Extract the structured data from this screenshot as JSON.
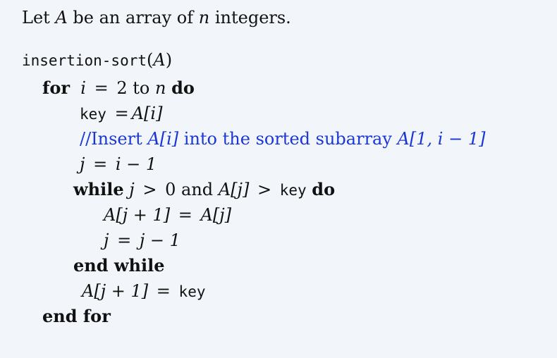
{
  "intro": {
    "pre": "Let",
    "var_A": "A",
    "mid": "be an array of",
    "var_n": "n",
    "post": "integers."
  },
  "code": {
    "func_name": "insertion-sort",
    "func_open": "(",
    "func_arg": "A",
    "func_close": ")",
    "for_kw": "for",
    "for_var": "i",
    "for_eq": "=",
    "for_start": "2",
    "for_to": "to",
    "for_end": "n",
    "for_do": "do",
    "key_name": "key",
    "key_eq": "=",
    "key_A": "A",
    "key_idx": "[i]",
    "comment_slashes": "//",
    "comment_text": "Insert",
    "comment_A": "A",
    "comment_idx": "[i]",
    "comment_mid": "into the sorted subarray",
    "comment_A2": "A",
    "comment_range": "[1, i − 1]",
    "j_var": "j",
    "j_eq": "=",
    "j_rhs": "i − 1",
    "while_kw": "while",
    "while_j": "j",
    "while_gt1": ">",
    "while_zero": "0",
    "while_and": "and",
    "while_A": "A",
    "while_idx": "[j]",
    "while_gt2": ">",
    "while_key": "key",
    "while_do": "do",
    "shift_lhs_A": "A",
    "shift_lhs_idx": "[j + 1]",
    "shift_eq": "=",
    "shift_rhs_A": "A",
    "shift_rhs_idx": "[j]",
    "dec_j": "j",
    "dec_eq": "=",
    "dec_rhs": "j − 1",
    "end_while": "end while",
    "assign_A": "A",
    "assign_idx": "[j + 1]",
    "assign_eq": "=",
    "assign_key": "key",
    "end_for": "end for"
  }
}
